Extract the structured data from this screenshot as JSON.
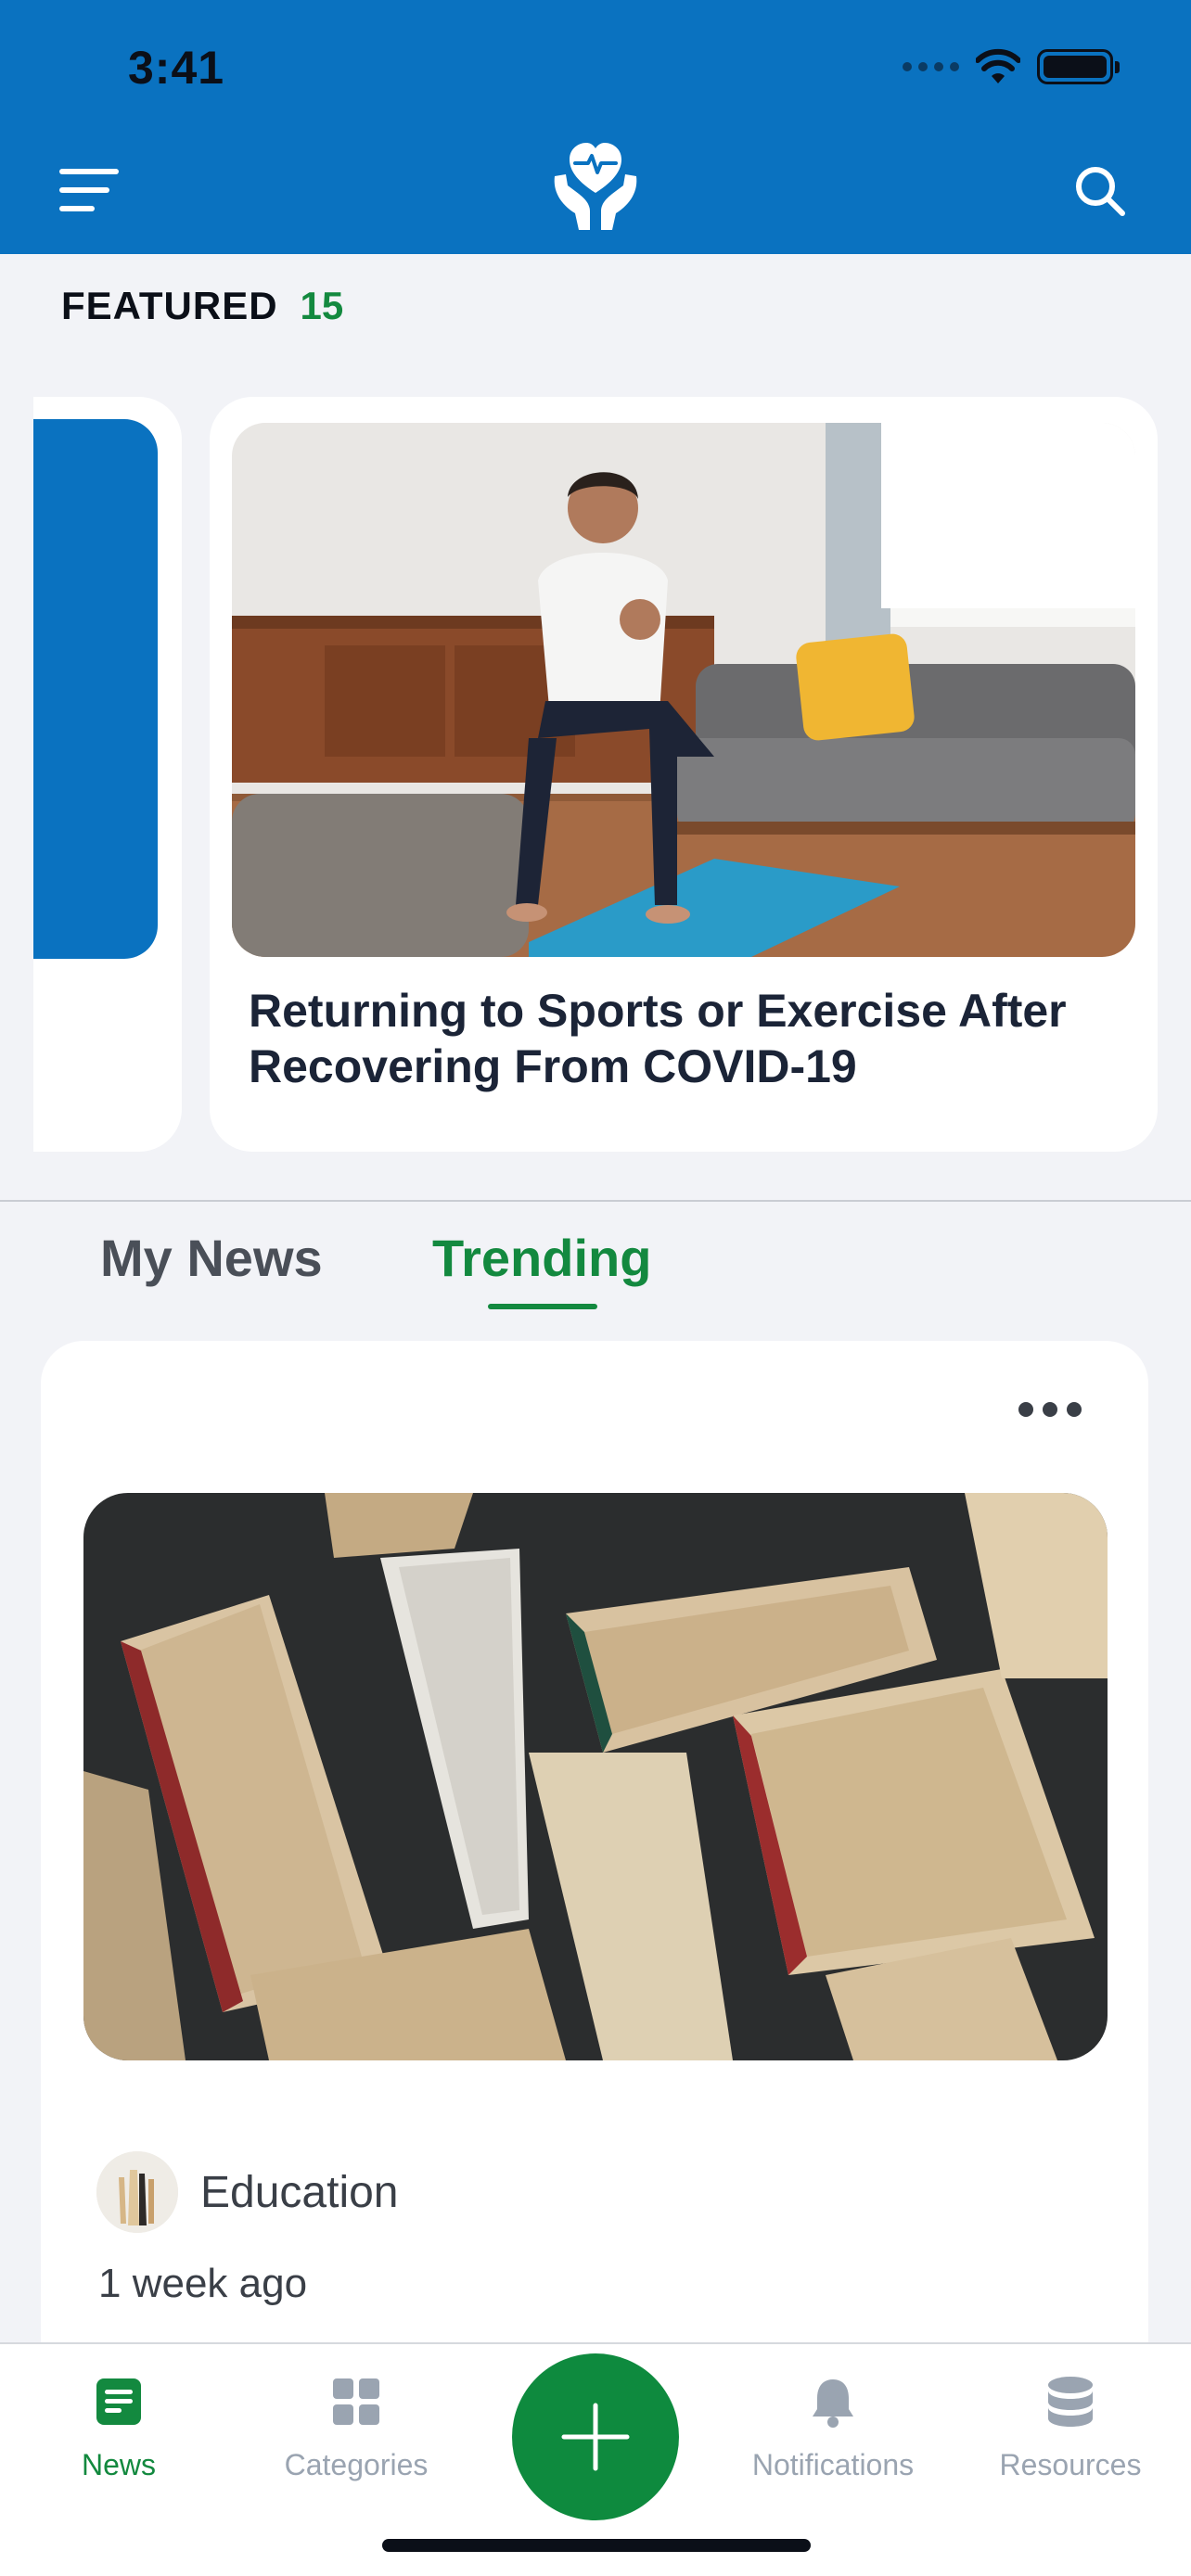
{
  "status_bar": {
    "time": "3:41"
  },
  "featured": {
    "label": "FEATURED",
    "count": "15",
    "card_title": "Returning to Sports or Exercise After Recovering From COVID-19"
  },
  "tabs": [
    {
      "label": "My News",
      "active": false
    },
    {
      "label": "Trending",
      "active": true
    }
  ],
  "news_card": {
    "category": "Education",
    "time": "1 week ago"
  },
  "bottom_nav": {
    "items": [
      {
        "label": "News",
        "icon": "document-icon",
        "active": true
      },
      {
        "label": "Categories",
        "icon": "grid-icon",
        "active": false
      },
      {
        "label": "Notifications",
        "icon": "bell-icon",
        "active": false
      },
      {
        "label": "Resources",
        "icon": "database-icon",
        "active": false
      }
    ],
    "fab_icon": "plus-icon"
  },
  "colors": {
    "header_blue": "#0a72c0",
    "accent_green": "#13893f",
    "fab_green": "#0e8a3e",
    "background": "#f2f3f7"
  }
}
